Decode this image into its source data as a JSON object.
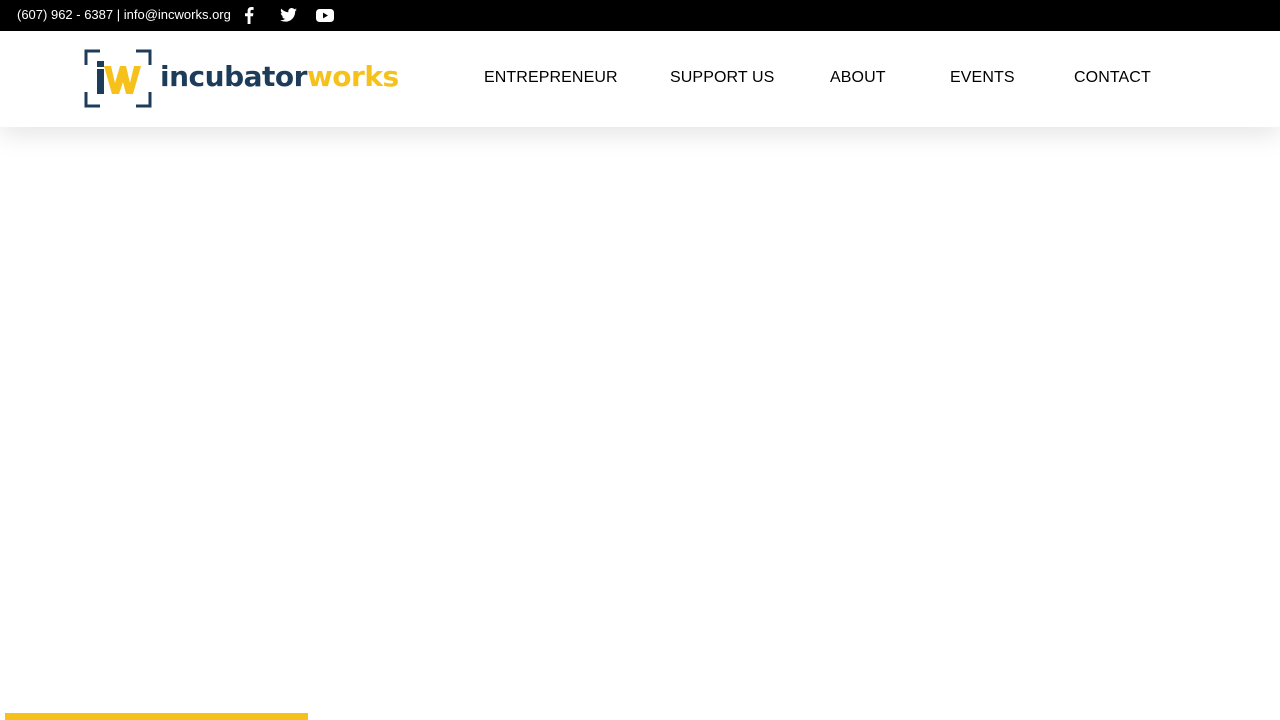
{
  "topbar": {
    "phone": "(607) 962 - 6387",
    "separator": " | ",
    "email": "info@incworks.org"
  },
  "social": [
    {
      "icon": "facebook-icon"
    },
    {
      "icon": "twitter-icon"
    },
    {
      "icon": "youtube-icon"
    }
  ],
  "logo": {
    "part1": "incubator",
    "part2": "works",
    "brand_blue": "#1d3c5a",
    "brand_yellow": "#f5c11a"
  },
  "nav": {
    "items": [
      {
        "label": "ENTREPRENEUR"
      },
      {
        "label": "SUPPORT US"
      },
      {
        "label": "ABOUT"
      },
      {
        "label": "EVENTS"
      },
      {
        "label": "CONTACT"
      }
    ]
  },
  "colors": {
    "topbar_bg": "#000000",
    "accent": "#f5c11a"
  }
}
